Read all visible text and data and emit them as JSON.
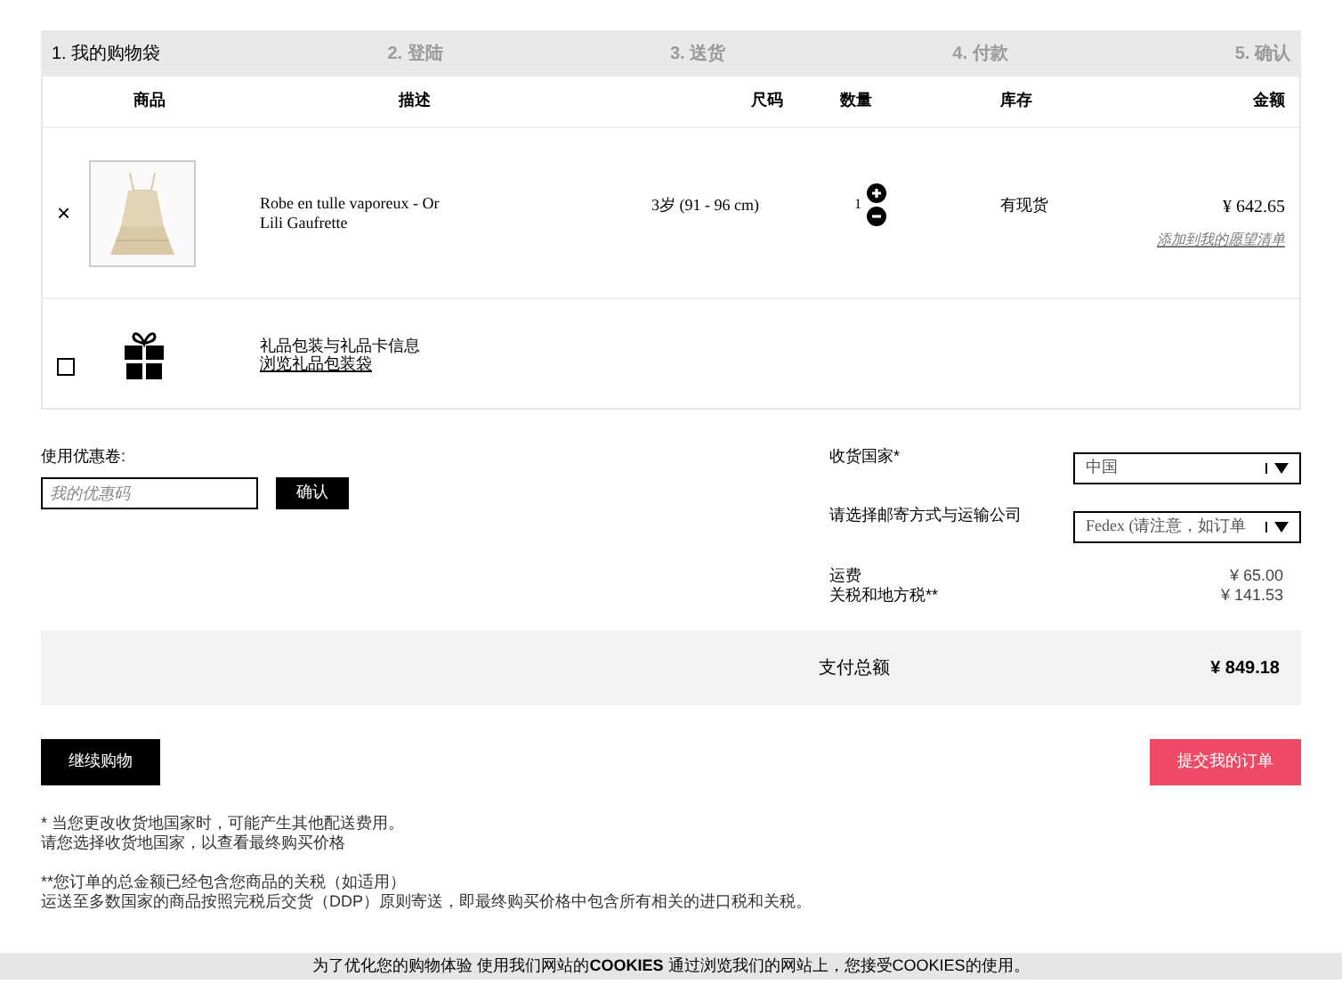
{
  "steps": [
    {
      "label": "1. 我的购物袋",
      "selected": true
    },
    {
      "label": "2. 登陆",
      "selected": false
    },
    {
      "label": "3. 送货",
      "selected": false
    },
    {
      "label": "4. 付款",
      "selected": false
    },
    {
      "label": "5. 确认",
      "selected": false
    }
  ],
  "table": {
    "columns": [
      "商品",
      "描述",
      "尺码",
      "数量",
      "库存",
      "金额"
    ],
    "item": {
      "remove": "×",
      "name": "Robe en tulle vaporeux - Or",
      "brand": "Lili Gaufrette",
      "size": "3岁 (91 - 96 cm)",
      "quantity": "1",
      "stock": "有现货",
      "price": "¥ 642.65",
      "wishlist_link": "添加到我的愿望清单"
    },
    "gift": {
      "checked": false,
      "title": "礼品包装与礼品卡信息",
      "link": "浏览礼品包装袋"
    }
  },
  "coupon": {
    "label": "使用优惠卷:",
    "placeholder": "我的优惠码",
    "button": "确认"
  },
  "shipping": {
    "country_label": "收货国家*",
    "country_value": "中国",
    "carrier_label": "请选择邮寄方式与运输公司",
    "carrier_value": "Fedex (请注意，如订单"
  },
  "fees": [
    {
      "label": "运费",
      "value": "¥ 65.00"
    },
    {
      "label": "关税和地方税**",
      "value": "¥ 141.53"
    }
  ],
  "total": {
    "label": "支付总额",
    "value": "¥ 849.18"
  },
  "buttons": {
    "continue": "继续购物",
    "submit": "提交我的订单"
  },
  "notes": [
    "* 当您更改收货地国家时，可能产生其他配送费用。",
    "请您选择收货地国家，以查看最终购买价格",
    "**您订单的总金额已经包含您商品的关税（如适用）",
    "运送至多数国家的商品按照完税后交货（DDP）原则寄送，即最终购买价格中包含所有相关的进口税和关税。"
  ],
  "cookie_bar": "为了优化您的购物体验 使用我们网站的**COOKIES** 通过浏览我们的网站上，您接受COOKIES的使用。"
}
